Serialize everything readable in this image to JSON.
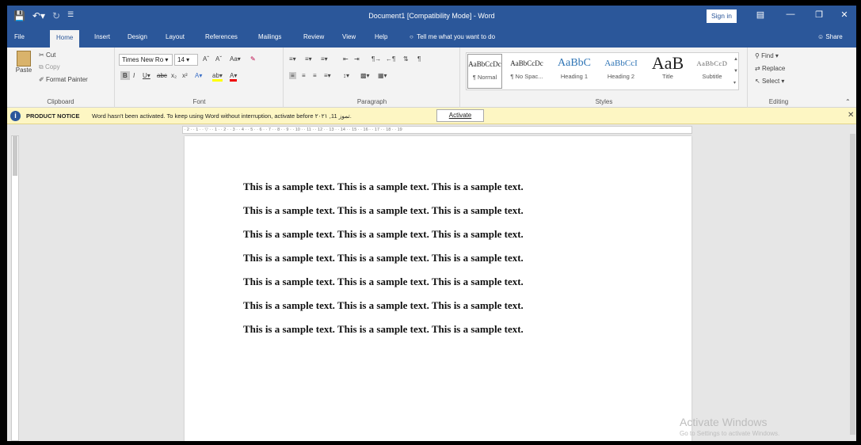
{
  "window": {
    "title": "Document1 [Compatibility Mode] - Word",
    "sign_in": "Sign in",
    "brand_color": "#2b579a"
  },
  "tabs": [
    "File",
    "Home",
    "Insert",
    "Design",
    "Layout",
    "References",
    "Mailings",
    "Review",
    "View",
    "Help"
  ],
  "active_tab": "Home",
  "tell_me": "Tell me what you want to do",
  "share": "Share",
  "ribbon": {
    "clipboard": {
      "paste": "Paste",
      "cut": "Cut",
      "copy": "Copy",
      "format_painter": "Format Painter",
      "label": "Clipboard"
    },
    "font": {
      "font_name": "Times New Ro",
      "font_size": "14",
      "label": "Font"
    },
    "paragraph": {
      "label": "Paragraph"
    },
    "styles": {
      "label": "Styles",
      "items": [
        {
          "sample": "AaBbCcDc",
          "name": "¶ Normal"
        },
        {
          "sample": "AaBbCcDc",
          "name": "¶ No Spac..."
        },
        {
          "sample": "AaBbC",
          "name": "Heading 1"
        },
        {
          "sample": "AaBbCcI",
          "name": "Heading 2"
        },
        {
          "sample": "AaB",
          "name": "Title"
        },
        {
          "sample": "AaBbCcD",
          "name": "Subtitle"
        }
      ]
    },
    "editing": {
      "find": "Find",
      "replace": "Replace",
      "select": "Select",
      "label": "Editing"
    }
  },
  "notice": {
    "title": "PRODUCT NOTICE",
    "message": "Word hasn't been activated. To keep using Word without interruption, activate before ۲۰۲۱ ,تموز 11.",
    "button": "Activate"
  },
  "document": {
    "lines": [
      "This is a sample text. This is a sample text. This is a sample text.",
      "This is a sample text. This is a sample text. This is a sample text.",
      "This is a sample text. This is a sample text. This is a sample text.",
      "This is a sample text. This is a sample text. This is a sample text.",
      "This is a sample text. This is a sample text. This is a sample text.",
      "This is a sample text. This is a sample text. This is a sample text.",
      "This is a sample text. This is a sample text. This is a sample text."
    ]
  },
  "watermark": {
    "title": "Activate Windows",
    "subtitle": "Go to Settings to activate Windows."
  }
}
